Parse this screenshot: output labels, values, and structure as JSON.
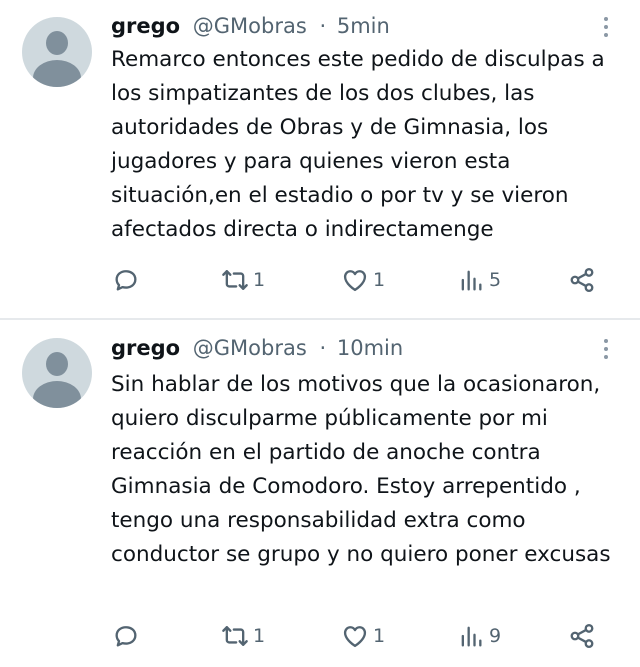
{
  "tweets": [
    {
      "name": "grego",
      "handle": "@GMobras",
      "separator": "·",
      "time": "5min",
      "text": "Remarco entonces este pedido de disculpas a los simpatizantes de los dos clubes, las autoridades de Obras y de Gimnasia, los jugadores y para quienes vieron esta situación,en el estadio o por tv y se vieron afectados directa o indirectamenge",
      "retweets": "1",
      "likes": "1",
      "views": "5"
    },
    {
      "name": "grego",
      "handle": "@GMobras",
      "separator": "·",
      "time": "10min",
      "text": "Sin hablar de los motivos que la ocasionaron, quiero disculparme públicamente por mi reacción en el partido de anoche contra Gimnasia de Comodoro. Estoy arrepentido , tengo una responsabilidad extra como conductor se grupo y no quiero poner excusas",
      "retweets": "1",
      "likes": "1",
      "views": "9"
    }
  ],
  "icons": [
    "avatar",
    "more-icon",
    "reply-icon",
    "retweet-icon",
    "like-icon",
    "views-icon",
    "share-icon"
  ],
  "colors": {
    "text": "#0f1419",
    "secondary": "#536471",
    "divider": "#e6e9ec",
    "avatar": "#cfd9de"
  }
}
